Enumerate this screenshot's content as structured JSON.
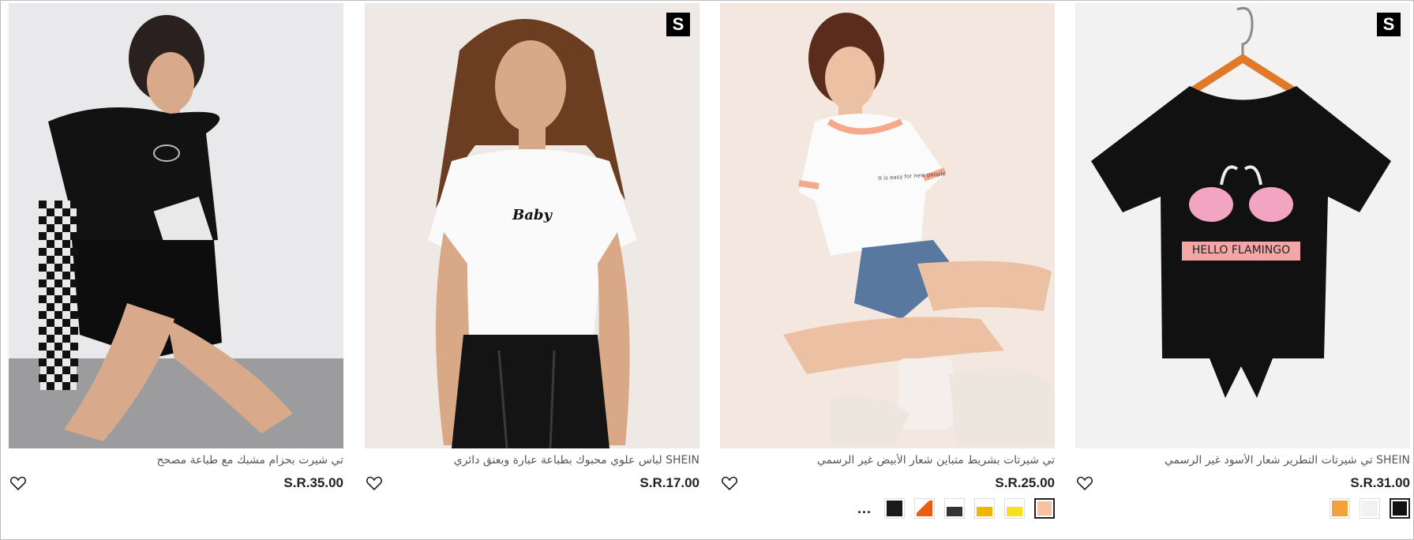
{
  "products": [
    {
      "title": "تي شيرت بحزام مشبك مع طباعة مصحح",
      "price": "S.R.35.00",
      "badge": "",
      "swatches": [],
      "more": ""
    },
    {
      "title": "SHEIN لباس علوي محبوك بطباعة عبارة وبعنق دائري",
      "price": "S.R.17.00",
      "badge": "S",
      "swatches": [],
      "more": ""
    },
    {
      "title": "تي شيرتات بشريط متباين شعار الأبيض غير الرسمي",
      "price": "S.R.25.00",
      "badge": "",
      "swatches": [
        "#f6c2a4",
        "#f5e21c",
        "#f4b400",
        "#333333",
        "#e85d12",
        "#1a1a1a"
      ],
      "more": "..."
    },
    {
      "title": "SHEIN تي شيرتات التطرير شعار الأسود غير الرسمي",
      "price": "S.R.31.00",
      "badge": "S",
      "swatches": [
        "#111111",
        "#f2f2f2",
        "#f2a23a"
      ],
      "more": ""
    }
  ],
  "colors": {
    "accent": "#222222",
    "badge_bg": "#000000",
    "title_text": "#555555"
  },
  "icons": {
    "wishlist": "heart-outline-icon",
    "brand": "shein-badge-icon"
  },
  "shirt_prints": {
    "baby": "Baby",
    "flamingo": "HELLO FLAMINGO"
  }
}
